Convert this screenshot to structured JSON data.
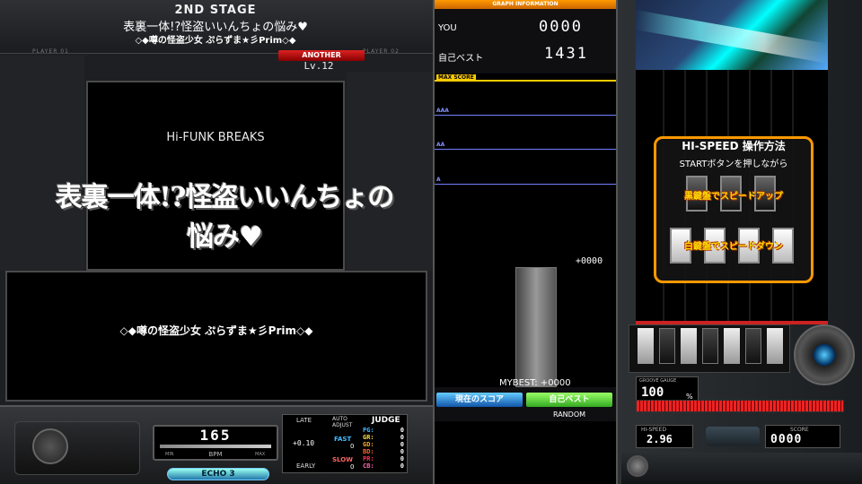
{
  "header": {
    "stage": "2ND STAGE",
    "title": "表裏一体!?怪盗いいんちょの悩み♥",
    "artist": "◇◆噂の怪盗少女 ぷらずま★彡Prim◇◆",
    "player1": "PLAYER 01",
    "player2": "PLAYER 02",
    "difficulty": "ANOTHER",
    "level": "Lv.12"
  },
  "banner": {
    "genre": "Hi-FUNK BREAKS",
    "title": "表裏一体!?怪盗いいんちょの悩み♥"
  },
  "artist_box": {
    "artist": "◇◆噂の怪盗少女 ぷらずま★彡Prim◇◆"
  },
  "bpm": {
    "value": "165",
    "label": "BPM",
    "min_label": "MIN",
    "max_label": "MAX"
  },
  "effect": "ECHO 3",
  "judge": {
    "late_label": "LATE",
    "auto_adjust_label": "AUTO ADJUST",
    "title": "JUDGE",
    "offset": "+0.10",
    "fast_label": "FAST",
    "fast_value": "0",
    "slow_label": "SLOW",
    "slow_value": "0",
    "early_label": "EARLY",
    "rows": [
      {
        "label": "PG:",
        "value": "0",
        "color": "#44bbff"
      },
      {
        "label": "GR:",
        "value": "0",
        "color": "#ffdd44"
      },
      {
        "label": "GD:",
        "value": "0",
        "color": "#ffaa22"
      },
      {
        "label": "BD:",
        "value": "0",
        "color": "#ff6633"
      },
      {
        "label": "PR:",
        "value": "0",
        "color": "#ff3355"
      },
      {
        "label": "CB:",
        "value": "0",
        "color": "#ff66aa"
      }
    ]
  },
  "graph": {
    "header": "GRAPH INFORMATION",
    "you_label": "YOU",
    "you_score": "0000",
    "best_label": "自己ベスト",
    "best_score": "1431",
    "max_label": "MAX SCORE",
    "aaa_label": "AAA",
    "aa_label": "AA",
    "a_label": "A",
    "diff": "+0000",
    "mybest": "MYBEST: +0000",
    "tab_current": "現在のスコア",
    "tab_best": "自己ベスト",
    "random": "RANDOM"
  },
  "hispeed_help": {
    "title": "HI-SPEED 操作方法",
    "subtitle": "STARTボタンを押しながら",
    "up": "黒鍵盤でスピードアップ",
    "down": "白鍵盤でスピードダウン"
  },
  "gauge": {
    "label": "GROOVE GAUGE",
    "value": "100",
    "unit": "%"
  },
  "hispeed": {
    "label": "HI-SPEED",
    "value": "2.96"
  },
  "score": {
    "label": "SCORE",
    "value": "0000"
  }
}
